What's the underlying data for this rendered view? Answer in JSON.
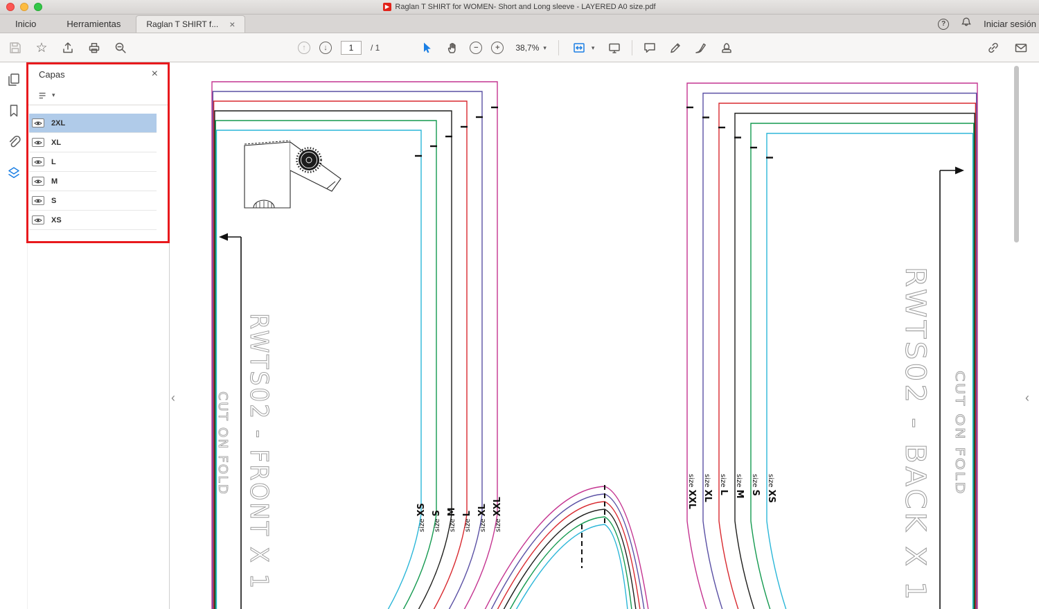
{
  "window": {
    "title": "Raglan T SHIRT for WOMEN- Short and Long sleeve - LAYERED A0 size.pdf"
  },
  "tabbar": {
    "menu": [
      {
        "label": "Inicio"
      },
      {
        "label": "Herramientas"
      }
    ],
    "document_tab": {
      "label": "Raglan T SHIRT f..."
    },
    "signin_label": "Iniciar sesión"
  },
  "toolbar": {
    "page_current": "1",
    "page_total": "/ 1",
    "zoom_value": "38,7%"
  },
  "layers_panel": {
    "title": "Capas",
    "layers": [
      {
        "label": "2XL",
        "selected": true
      },
      {
        "label": "XL",
        "selected": false
      },
      {
        "label": "L",
        "selected": false
      },
      {
        "label": "M",
        "selected": false
      },
      {
        "label": "S",
        "selected": false
      },
      {
        "label": "XS",
        "selected": false
      }
    ]
  },
  "document": {
    "front_label": "RWTS02 - FRONT X 1",
    "back_label": "RWTS02 - BACK X 1",
    "cut_on_fold": "CUT ON FOLD",
    "front_sizes": [
      "size XS",
      "size S",
      "size M",
      "size L",
      "size XL",
      "size XXL"
    ],
    "back_sizes": [
      "size XXL",
      "size XL",
      "size L",
      "size M",
      "size S",
      "size XS"
    ],
    "layer_colors": [
      "#c43390",
      "#5a50a4",
      "#d8282e",
      "#1d1d1b",
      "#13994f",
      "#2ab6d8"
    ],
    "accent_blue": "#1b7fe4",
    "annotation_red": "#e8191d"
  },
  "icons": {
    "star": "☆",
    "arrow_up": "↑",
    "arrow_down": "↓",
    "minus": "−",
    "plus": "+",
    "caret_down": "▾",
    "help": "?",
    "close": "×",
    "chevron_left": "‹"
  }
}
